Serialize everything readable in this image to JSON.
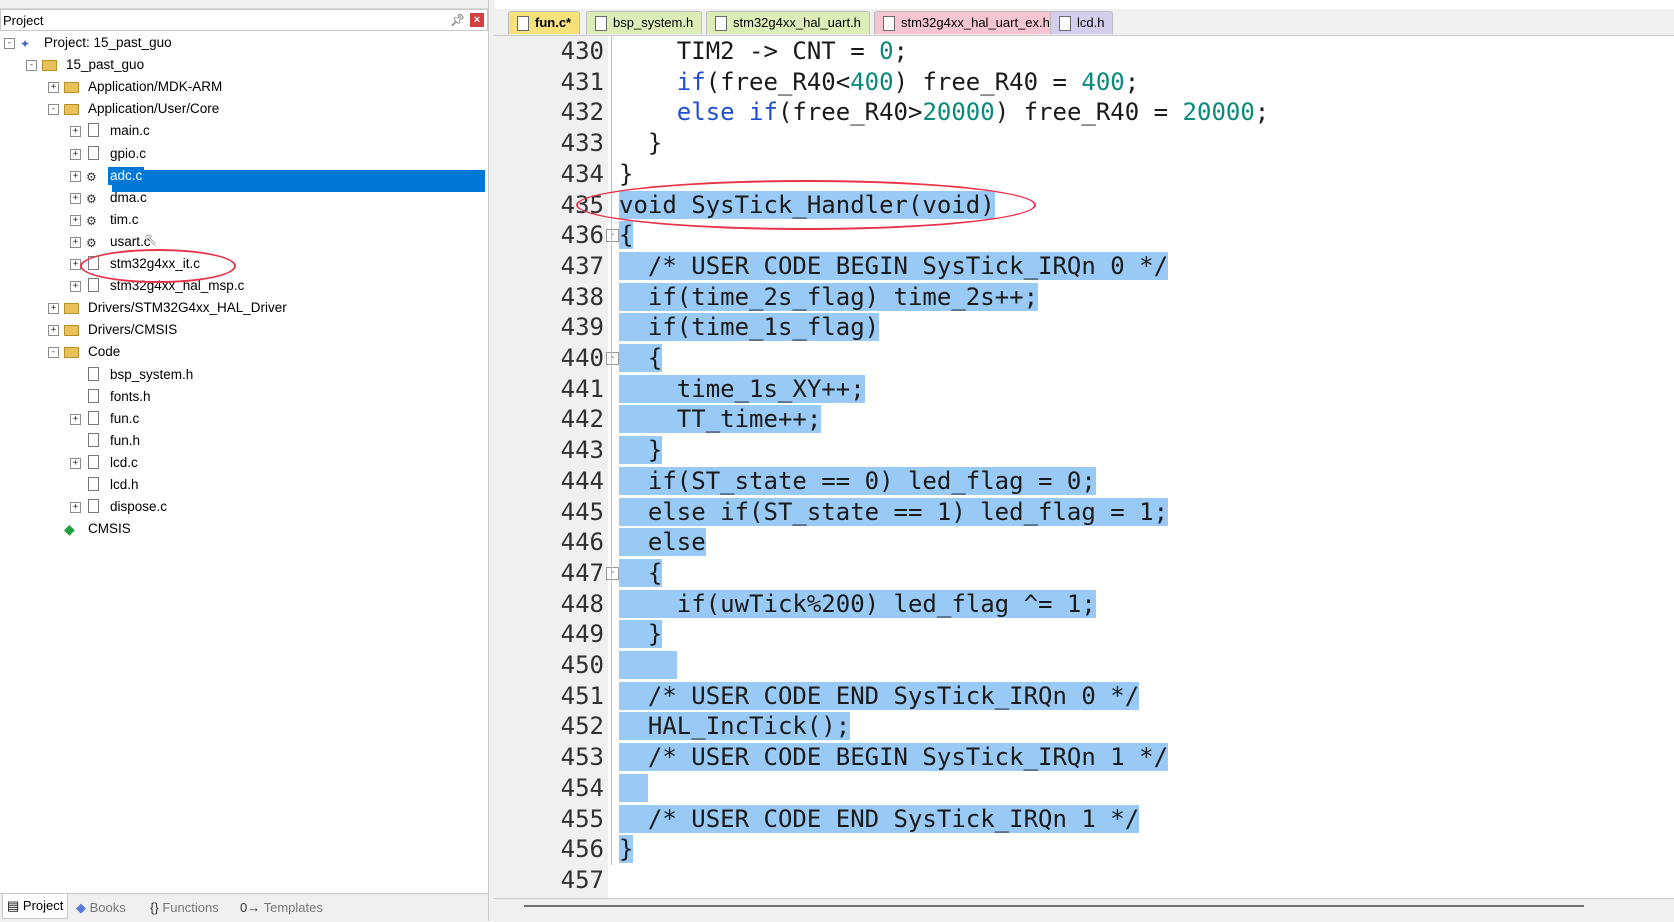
{
  "project_panel": {
    "title": "Project",
    "tree": [
      {
        "label": "Project: 15_past_guo"
      },
      {
        "label": "15_past_guo"
      },
      {
        "label": "Application/MDK-ARM"
      },
      {
        "label": "Application/User/Core"
      },
      {
        "label": "main.c"
      },
      {
        "label": "gpio.c"
      },
      {
        "label": "adc.c",
        "selected": true
      },
      {
        "label": "dma.c"
      },
      {
        "label": "tim.c"
      },
      {
        "label": "usart.c"
      },
      {
        "label": "stm32g4xx_it.c",
        "circled": true
      },
      {
        "label": "stm32g4xx_hal_msp.c"
      },
      {
        "label": "Drivers/STM32G4xx_HAL_Driver"
      },
      {
        "label": "Drivers/CMSIS"
      },
      {
        "label": "Code"
      },
      {
        "label": "bsp_system.h"
      },
      {
        "label": "fonts.h"
      },
      {
        "label": "fun.c"
      },
      {
        "label": "fun.h"
      },
      {
        "label": "lcd.c"
      },
      {
        "label": "lcd.h"
      },
      {
        "label": "dispose.c"
      },
      {
        "label": "CMSIS"
      }
    ],
    "bottom_tabs": [
      "Project",
      "Books",
      "Functions",
      "Templates"
    ]
  },
  "editor": {
    "tabs": [
      {
        "label": "fun.c*",
        "color": "#f5e27a"
      },
      {
        "label": "bsp_system.h",
        "color": "#dcedb8"
      },
      {
        "label": "stm32g4xx_hal_uart.h",
        "color": "#dcedb8"
      },
      {
        "label": "stm32g4xx_hal_uart_ex.h",
        "color": "#f6c6d0"
      },
      {
        "label": "lcd.h",
        "color": "#d5cdee"
      }
    ],
    "line_numbers": [
      "430",
      "431",
      "432",
      "433",
      "434",
      "435",
      "436",
      "437",
      "438",
      "439",
      "440",
      "441",
      "442",
      "443",
      "444",
      "445",
      "446",
      "447",
      "448",
      "449",
      "450",
      "451",
      "452",
      "453",
      "454",
      "455",
      "456",
      "457"
    ],
    "code_lines": [
      "    TIM2 -> CNT = 0;",
      "    if(free_R40<400) free_R40 = 400;",
      "    else if(free_R40>20000) free_R40 = 20000;",
      "  }",
      "}",
      "void SysTick_Handler(void)",
      "{",
      "  /* USER CODE BEGIN SysTick_IRQn 0 */",
      "  if(time_2s_flag) time_2s++;",
      "  if(time_1s_flag)",
      "  {",
      "    time_1s_XY++;",
      "    TT_time++;",
      "  }",
      "  if(ST_state == 0) led_flag = 0;",
      "  else if(ST_state == 1) led_flag = 1;",
      "  else",
      "  {",
      "    if(uwTick%200) led_flag ^= 1;",
      "  }",
      "",
      "  /* USER CODE END SysTick_IRQn 0 */",
      "  HAL_IncTick();",
      "  /* USER CODE BEGIN SysTick_IRQn 1 */",
      "",
      "  /* USER CODE END SysTick_IRQn 1 */",
      "}",
      ""
    ],
    "colors": {
      "selection": "#99c9f5",
      "keyword": "#1f4fd0",
      "number": "#0a8a7a",
      "annotation": "#e8334a"
    }
  }
}
